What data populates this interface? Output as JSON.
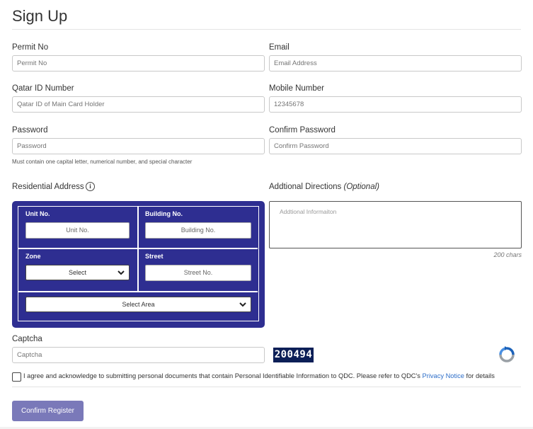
{
  "page": {
    "title": "Sign Up"
  },
  "fields": {
    "permit": {
      "label": "Permit No",
      "placeholder": "Permit No"
    },
    "email": {
      "label": "Email",
      "placeholder": "Email Address"
    },
    "qatar_id": {
      "label": "Qatar ID Number",
      "placeholder": "Qatar ID of Main Card Holder"
    },
    "mobile": {
      "label": "Mobile Number",
      "placeholder": "12345678"
    },
    "password": {
      "label": "Password",
      "placeholder": "Password",
      "hint": "Must contain one capital letter, numerical number, and special character"
    },
    "confirm_password": {
      "label": "Confirm Password",
      "placeholder": "Confirm Password"
    }
  },
  "address": {
    "label": "Residential Address",
    "info_icon": "info-icon",
    "unit": {
      "label": "Unit No.",
      "placeholder": "Unit No."
    },
    "building": {
      "label": "Building No.",
      "placeholder": "Building No."
    },
    "zone": {
      "label": "Zone",
      "selected": "Select"
    },
    "street": {
      "label": "Street",
      "placeholder": "Street No."
    },
    "area": {
      "selected": "Select Area"
    },
    "box_color": "#2e2e91"
  },
  "directions": {
    "label": "Addtional Directions",
    "optional": "(Optional)",
    "placeholder": "Addtional Informaiton",
    "char_limit": "200 chars"
  },
  "captcha": {
    "label": "Captcha",
    "placeholder": "Captcha",
    "code": "200494",
    "refresh_icon": "recaptcha-refresh-icon"
  },
  "agreement": {
    "text": "I agree and acknowledge to submitting personal documents that contain Personal Identifiable Information to QDC. Please refer to QDC's",
    "link": "Privacy Notice",
    "suffix": "for details",
    "checked": false
  },
  "actions": {
    "confirm_label": "Confirm Register",
    "confirm_color": "#7a79b9"
  }
}
